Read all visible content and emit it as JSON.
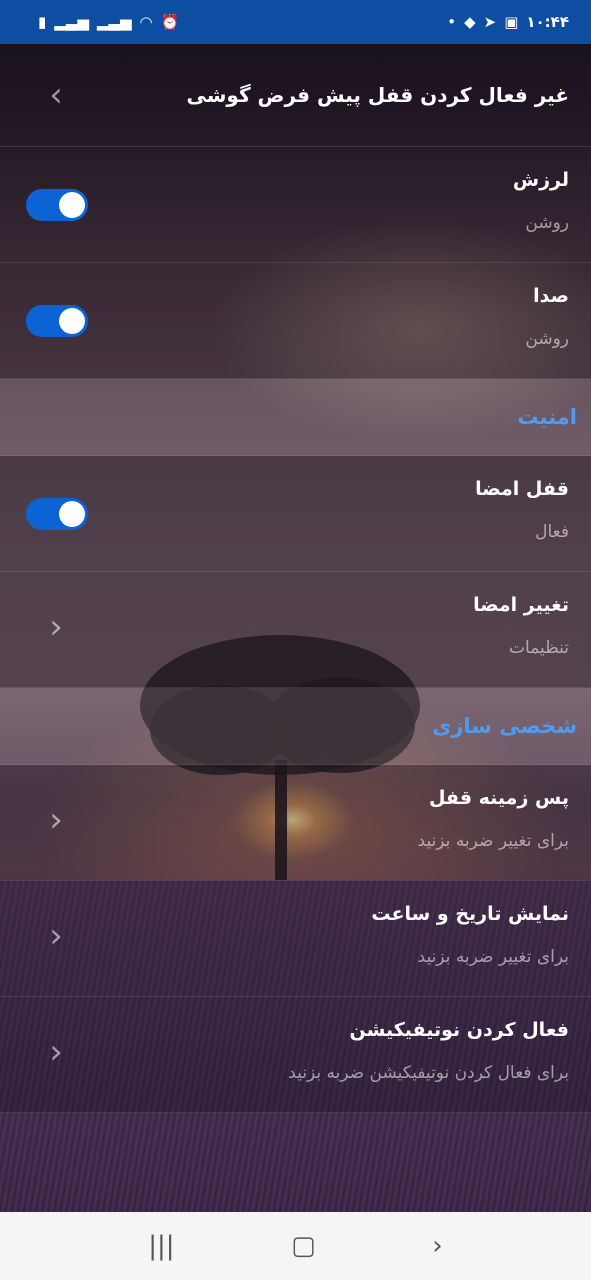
{
  "status_bar": {
    "time": "۱۰:۴۴",
    "left_icons": [
      "battery-icon",
      "signal-icon",
      "signal-icon-2",
      "wifi-icon",
      "alarm-icon"
    ],
    "right_icons": [
      "dot-icon",
      "bag-icon",
      "send-icon",
      "image-icon"
    ]
  },
  "header": {
    "title": "غیر فعال کردن قفل پیش فرض گوشی"
  },
  "rows": [
    {
      "title": "لرزش",
      "subtitle": "روشن",
      "control": "toggle",
      "on": true
    },
    {
      "title": "صدا",
      "subtitle": "روشن",
      "control": "toggle",
      "on": true
    }
  ],
  "section_security": {
    "label": "امنیت"
  },
  "security_rows": [
    {
      "title": "قفل امضا",
      "subtitle": "فعال",
      "control": "toggle",
      "on": true
    },
    {
      "title": "تغییر امضا",
      "subtitle": "تنظیمات",
      "control": "chevron"
    }
  ],
  "section_personalize": {
    "label": "شخصی سازی"
  },
  "personalize_rows": [
    {
      "title": "پس زمینه قفل",
      "subtitle": "برای تغییر ضربه بزنید",
      "control": "chevron"
    },
    {
      "title": "نمایش تاریخ و ساعت",
      "subtitle": "برای تغییر ضربه بزنید",
      "control": "chevron"
    },
    {
      "title": "فعال کردن نوتیفیکیشن",
      "subtitle": "برای فعال کردن نوتیفیکیشن ضربه بزنید",
      "control": "chevron"
    }
  ],
  "colors": {
    "status_bar": "#0d4ea3",
    "toggle_on": "#0b63d6",
    "section_label": "#4e9bf0"
  },
  "nav": {
    "recents_icon": "recents-icon",
    "home_icon": "home-icon",
    "back_icon": "back-icon"
  }
}
